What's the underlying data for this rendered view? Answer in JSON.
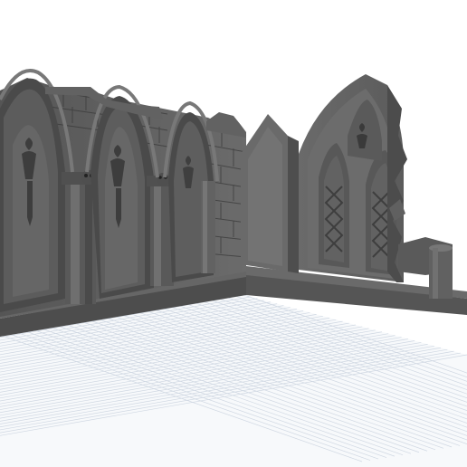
{
  "scene": {
    "subject": "3d-model-preview",
    "colors": {
      "background": "#ffffff",
      "grid_line": "#d6dde7",
      "grid_major": "#b9c4d3",
      "stone_light": "#6e6e6e",
      "stone_mid": "#5a5a5a",
      "stone_dark": "#3f3f3f",
      "stone_shadow": "#2e2e2e"
    }
  }
}
